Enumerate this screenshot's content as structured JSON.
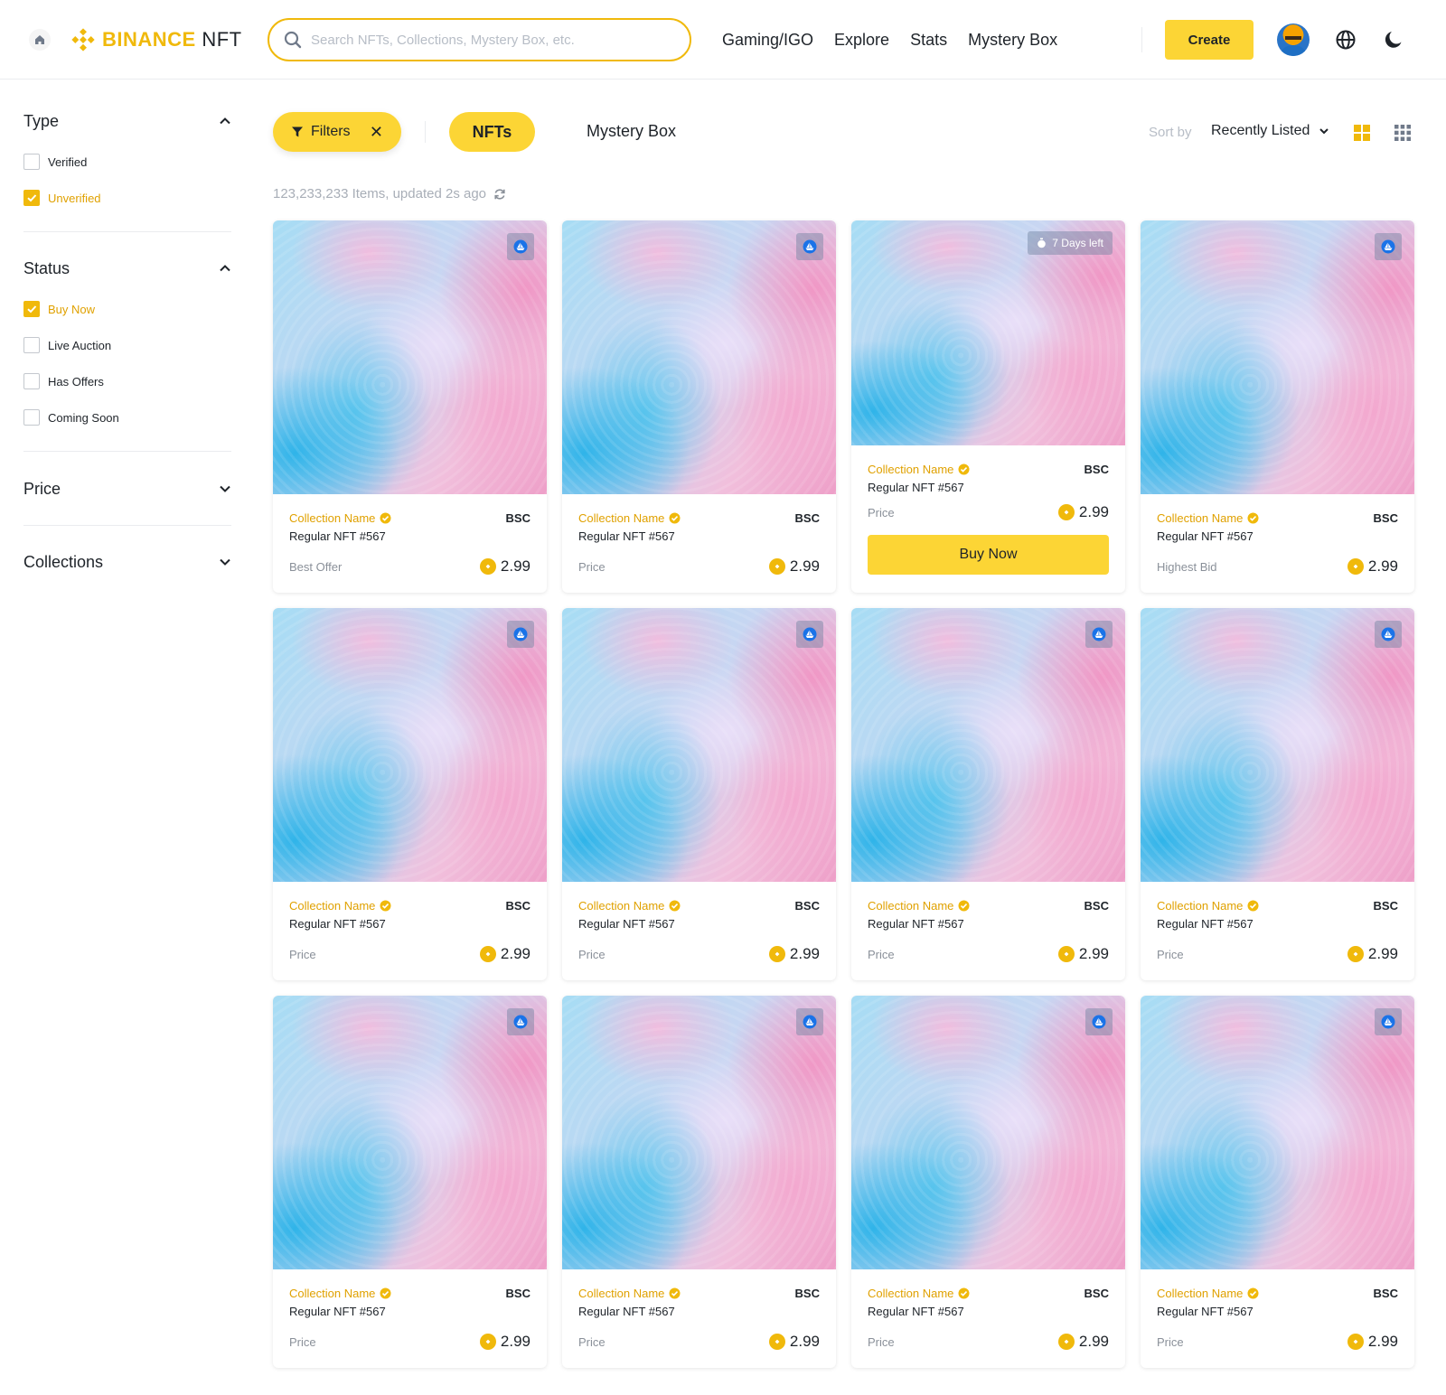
{
  "header": {
    "logo_brand": "BINANCE",
    "logo_suffix": "NFT",
    "search_placeholder": "Search NFTs, Collections, Mystery Box, etc.",
    "nav": [
      "Gaming/IGO",
      "Explore",
      "Stats",
      "Mystery Box"
    ],
    "create_label": "Create"
  },
  "sidebar": {
    "type": {
      "title": "Type",
      "options": [
        {
          "label": "Verified",
          "checked": false
        },
        {
          "label": "Unverified",
          "checked": true
        }
      ]
    },
    "status": {
      "title": "Status",
      "options": [
        {
          "label": "Buy Now",
          "checked": true
        },
        {
          "label": "Live Auction",
          "checked": false
        },
        {
          "label": "Has Offers",
          "checked": false
        },
        {
          "label": "Coming Soon",
          "checked": false
        }
      ]
    },
    "price": {
      "title": "Price"
    },
    "collections": {
      "title": "Collections"
    }
  },
  "toolbar": {
    "filters_label": "Filters",
    "nfts_label": "NFTs",
    "mystery_box_label": "Mystery Box",
    "sort_by_label": "Sort by",
    "sort_value": "Recently Listed",
    "items_status": "123,233,233 Items, updated 2s ago"
  },
  "colors": {
    "accent": "#fcd535",
    "brand": "#f0b90b",
    "collection_text": "#e0a100"
  },
  "cards": [
    {
      "collection": "Collection Name",
      "chain": "BSC",
      "name": "Regular NFT #567",
      "price_label": "Best Offer",
      "price": "2.99"
    },
    {
      "collection": "Collection Name",
      "chain": "BSC",
      "name": "Regular NFT #567",
      "price_label": "Price",
      "price": "2.99"
    },
    {
      "collection": "Collection Name",
      "chain": "BSC",
      "name": "Regular NFT #567",
      "price_label": "Price",
      "price": "2.99",
      "badge": "7 Days left",
      "button": "Buy Now"
    },
    {
      "collection": "Collection Name",
      "chain": "BSC",
      "name": "Regular NFT #567",
      "price_label": "Highest Bid",
      "price": "2.99"
    },
    {
      "collection": "Collection Name",
      "chain": "BSC",
      "name": "Regular NFT #567",
      "price_label": "Price",
      "price": "2.99"
    },
    {
      "collection": "Collection Name",
      "chain": "BSC",
      "name": "Regular NFT #567",
      "price_label": "Price",
      "price": "2.99"
    },
    {
      "collection": "Collection Name",
      "chain": "BSC",
      "name": "Regular NFT #567",
      "price_label": "Price",
      "price": "2.99"
    },
    {
      "collection": "Collection Name",
      "chain": "BSC",
      "name": "Regular NFT #567",
      "price_label": "Price",
      "price": "2.99"
    },
    {
      "collection": "Collection Name",
      "chain": "BSC",
      "name": "Regular NFT #567",
      "price_label": "Price",
      "price": "2.99"
    },
    {
      "collection": "Collection Name",
      "chain": "BSC",
      "name": "Regular NFT #567",
      "price_label": "Price",
      "price": "2.99"
    },
    {
      "collection": "Collection Name",
      "chain": "BSC",
      "name": "Regular NFT #567",
      "price_label": "Price",
      "price": "2.99"
    },
    {
      "collection": "Collection Name",
      "chain": "BSC",
      "name": "Regular NFT #567",
      "price_label": "Price",
      "price": "2.99"
    }
  ]
}
